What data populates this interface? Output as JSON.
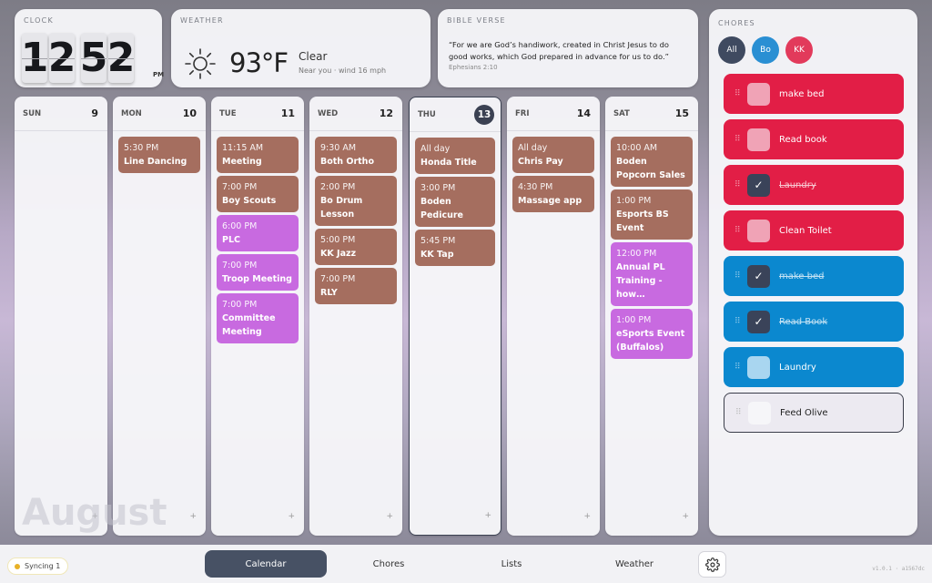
{
  "clock": {
    "title": "CLOCK",
    "digits": [
      "1",
      "2",
      "5",
      "2"
    ],
    "ampm": "PM"
  },
  "weather": {
    "title": "WEATHER",
    "icon": "sun-icon",
    "temp": "93°F",
    "condition": "Clear",
    "detail": "Near you · wind 16 mph"
  },
  "verse": {
    "title": "BIBLE VERSE",
    "text": "“For we are God’s handiwork, created in Christ Jesus to do good works, which God prepared in advance for us to do.”",
    "reference": "Ephesians 2:10"
  },
  "calendar": {
    "month": "August",
    "days": [
      {
        "name": "SUN",
        "date": "9",
        "today": false,
        "events": []
      },
      {
        "name": "MON",
        "date": "10",
        "today": false,
        "events": [
          {
            "time": "5:30 PM",
            "title": "Line Dancing",
            "color": "brown"
          }
        ]
      },
      {
        "name": "TUE",
        "date": "11",
        "today": false,
        "events": [
          {
            "time": "11:15 AM",
            "title": "Meeting",
            "color": "brown"
          },
          {
            "time": "7:00 PM",
            "title": "Boy Scouts",
            "color": "brown"
          },
          {
            "time": "6:00 PM",
            "title": "PLC",
            "color": "purple"
          },
          {
            "time": "7:00 PM",
            "title": "Troop Meeting",
            "color": "purple"
          },
          {
            "time": "7:00 PM",
            "title": "Committee Meeting",
            "color": "purple"
          }
        ]
      },
      {
        "name": "WED",
        "date": "12",
        "today": false,
        "events": [
          {
            "time": "9:30 AM",
            "title": "Both Ortho",
            "color": "brown"
          },
          {
            "time": "2:00 PM",
            "title": "Bo Drum Lesson",
            "color": "brown"
          },
          {
            "time": "5:00 PM",
            "title": "KK Jazz",
            "color": "brown"
          },
          {
            "time": "7:00 PM",
            "title": "RLY",
            "color": "brown"
          }
        ]
      },
      {
        "name": "THU",
        "date": "13",
        "today": true,
        "events": [
          {
            "time": "All day",
            "title": "Honda Title",
            "color": "brown"
          },
          {
            "time": "3:00 PM",
            "title": "Boden Pedicure",
            "color": "brown"
          },
          {
            "time": "5:45 PM",
            "title": "KK Tap",
            "color": "brown"
          }
        ]
      },
      {
        "name": "FRI",
        "date": "14",
        "today": false,
        "events": [
          {
            "time": "All day",
            "title": "Chris Pay",
            "color": "brown"
          },
          {
            "time": "4:30 PM",
            "title": "Massage app",
            "color": "brown"
          }
        ]
      },
      {
        "name": "SAT",
        "date": "15",
        "today": false,
        "events": [
          {
            "time": "10:00 AM",
            "title": "Boden Popcorn Sales",
            "color": "brown"
          },
          {
            "time": "1:00 PM",
            "title": "Esports BS Event",
            "color": "brown"
          },
          {
            "time": "12:00 PM",
            "title": "Annual PL Training - how…",
            "color": "purple"
          },
          {
            "time": "1:00 PM",
            "title": "eSports Event (Buffalos)",
            "color": "purple"
          }
        ]
      }
    ],
    "add_label": "+"
  },
  "chores": {
    "title": "CHORES",
    "filters": [
      {
        "label": "All",
        "color": "#3f4a60"
      },
      {
        "label": "Bo",
        "color": "#2a8fd3"
      },
      {
        "label": "KK",
        "color": "#e23a5b"
      }
    ],
    "items": [
      {
        "label": "make bed",
        "done": false,
        "color": "red"
      },
      {
        "label": "Read book",
        "done": false,
        "color": "red"
      },
      {
        "label": "Laundry",
        "done": true,
        "color": "red"
      },
      {
        "label": "Clean Toilet",
        "done": false,
        "color": "red"
      },
      {
        "label": "make bed",
        "done": true,
        "color": "blue"
      },
      {
        "label": "Read Book",
        "done": true,
        "color": "blue"
      },
      {
        "label": "Laundry",
        "done": false,
        "color": "blue"
      },
      {
        "label": "Feed Olive",
        "done": false,
        "color": "white"
      }
    ],
    "check_glyph": "✓",
    "drag_glyph": "⠿"
  },
  "bottom": {
    "sync": "Syncing 1",
    "tabs": [
      {
        "label": "Calendar",
        "active": true
      },
      {
        "label": "Chores",
        "active": false
      },
      {
        "label": "Lists",
        "active": false
      },
      {
        "label": "Weather",
        "active": false
      }
    ],
    "version": "v1.0.1 · a1567dc"
  }
}
